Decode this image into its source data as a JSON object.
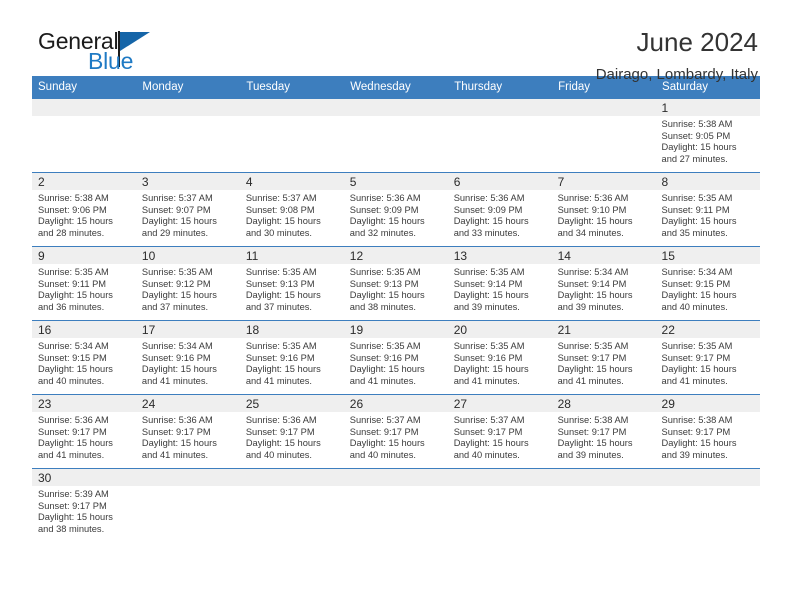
{
  "brand": {
    "name_top": "General",
    "name_bottom": "Blue",
    "accent_color": "#1f7ac4",
    "flag_color": "#1565a8"
  },
  "header": {
    "title": "June 2024",
    "location": "Dairago, Lombardy, Italy"
  },
  "calendar": {
    "header_bg": "#3d7ebe",
    "daynum_bg": "#efefef",
    "weekdays": [
      "Sunday",
      "Monday",
      "Tuesday",
      "Wednesday",
      "Thursday",
      "Friday",
      "Saturday"
    ],
    "weeks": [
      [
        {
          "day": "",
          "sunrise": "",
          "sunset": "",
          "daylight1": "",
          "daylight2": ""
        },
        {
          "day": "",
          "sunrise": "",
          "sunset": "",
          "daylight1": "",
          "daylight2": ""
        },
        {
          "day": "",
          "sunrise": "",
          "sunset": "",
          "daylight1": "",
          "daylight2": ""
        },
        {
          "day": "",
          "sunrise": "",
          "sunset": "",
          "daylight1": "",
          "daylight2": ""
        },
        {
          "day": "",
          "sunrise": "",
          "sunset": "",
          "daylight1": "",
          "daylight2": ""
        },
        {
          "day": "",
          "sunrise": "",
          "sunset": "",
          "daylight1": "",
          "daylight2": ""
        },
        {
          "day": "1",
          "sunrise": "Sunrise: 5:38 AM",
          "sunset": "Sunset: 9:05 PM",
          "daylight1": "Daylight: 15 hours",
          "daylight2": "and 27 minutes."
        }
      ],
      [
        {
          "day": "2",
          "sunrise": "Sunrise: 5:38 AM",
          "sunset": "Sunset: 9:06 PM",
          "daylight1": "Daylight: 15 hours",
          "daylight2": "and 28 minutes."
        },
        {
          "day": "3",
          "sunrise": "Sunrise: 5:37 AM",
          "sunset": "Sunset: 9:07 PM",
          "daylight1": "Daylight: 15 hours",
          "daylight2": "and 29 minutes."
        },
        {
          "day": "4",
          "sunrise": "Sunrise: 5:37 AM",
          "sunset": "Sunset: 9:08 PM",
          "daylight1": "Daylight: 15 hours",
          "daylight2": "and 30 minutes."
        },
        {
          "day": "5",
          "sunrise": "Sunrise: 5:36 AM",
          "sunset": "Sunset: 9:09 PM",
          "daylight1": "Daylight: 15 hours",
          "daylight2": "and 32 minutes."
        },
        {
          "day": "6",
          "sunrise": "Sunrise: 5:36 AM",
          "sunset": "Sunset: 9:09 PM",
          "daylight1": "Daylight: 15 hours",
          "daylight2": "and 33 minutes."
        },
        {
          "day": "7",
          "sunrise": "Sunrise: 5:36 AM",
          "sunset": "Sunset: 9:10 PM",
          "daylight1": "Daylight: 15 hours",
          "daylight2": "and 34 minutes."
        },
        {
          "day": "8",
          "sunrise": "Sunrise: 5:35 AM",
          "sunset": "Sunset: 9:11 PM",
          "daylight1": "Daylight: 15 hours",
          "daylight2": "and 35 minutes."
        }
      ],
      [
        {
          "day": "9",
          "sunrise": "Sunrise: 5:35 AM",
          "sunset": "Sunset: 9:11 PM",
          "daylight1": "Daylight: 15 hours",
          "daylight2": "and 36 minutes."
        },
        {
          "day": "10",
          "sunrise": "Sunrise: 5:35 AM",
          "sunset": "Sunset: 9:12 PM",
          "daylight1": "Daylight: 15 hours",
          "daylight2": "and 37 minutes."
        },
        {
          "day": "11",
          "sunrise": "Sunrise: 5:35 AM",
          "sunset": "Sunset: 9:13 PM",
          "daylight1": "Daylight: 15 hours",
          "daylight2": "and 37 minutes."
        },
        {
          "day": "12",
          "sunrise": "Sunrise: 5:35 AM",
          "sunset": "Sunset: 9:13 PM",
          "daylight1": "Daylight: 15 hours",
          "daylight2": "and 38 minutes."
        },
        {
          "day": "13",
          "sunrise": "Sunrise: 5:35 AM",
          "sunset": "Sunset: 9:14 PM",
          "daylight1": "Daylight: 15 hours",
          "daylight2": "and 39 minutes."
        },
        {
          "day": "14",
          "sunrise": "Sunrise: 5:34 AM",
          "sunset": "Sunset: 9:14 PM",
          "daylight1": "Daylight: 15 hours",
          "daylight2": "and 39 minutes."
        },
        {
          "day": "15",
          "sunrise": "Sunrise: 5:34 AM",
          "sunset": "Sunset: 9:15 PM",
          "daylight1": "Daylight: 15 hours",
          "daylight2": "and 40 minutes."
        }
      ],
      [
        {
          "day": "16",
          "sunrise": "Sunrise: 5:34 AM",
          "sunset": "Sunset: 9:15 PM",
          "daylight1": "Daylight: 15 hours",
          "daylight2": "and 40 minutes."
        },
        {
          "day": "17",
          "sunrise": "Sunrise: 5:34 AM",
          "sunset": "Sunset: 9:16 PM",
          "daylight1": "Daylight: 15 hours",
          "daylight2": "and 41 minutes."
        },
        {
          "day": "18",
          "sunrise": "Sunrise: 5:35 AM",
          "sunset": "Sunset: 9:16 PM",
          "daylight1": "Daylight: 15 hours",
          "daylight2": "and 41 minutes."
        },
        {
          "day": "19",
          "sunrise": "Sunrise: 5:35 AM",
          "sunset": "Sunset: 9:16 PM",
          "daylight1": "Daylight: 15 hours",
          "daylight2": "and 41 minutes."
        },
        {
          "day": "20",
          "sunrise": "Sunrise: 5:35 AM",
          "sunset": "Sunset: 9:16 PM",
          "daylight1": "Daylight: 15 hours",
          "daylight2": "and 41 minutes."
        },
        {
          "day": "21",
          "sunrise": "Sunrise: 5:35 AM",
          "sunset": "Sunset: 9:17 PM",
          "daylight1": "Daylight: 15 hours",
          "daylight2": "and 41 minutes."
        },
        {
          "day": "22",
          "sunrise": "Sunrise: 5:35 AM",
          "sunset": "Sunset: 9:17 PM",
          "daylight1": "Daylight: 15 hours",
          "daylight2": "and 41 minutes."
        }
      ],
      [
        {
          "day": "23",
          "sunrise": "Sunrise: 5:36 AM",
          "sunset": "Sunset: 9:17 PM",
          "daylight1": "Daylight: 15 hours",
          "daylight2": "and 41 minutes."
        },
        {
          "day": "24",
          "sunrise": "Sunrise: 5:36 AM",
          "sunset": "Sunset: 9:17 PM",
          "daylight1": "Daylight: 15 hours",
          "daylight2": "and 41 minutes."
        },
        {
          "day": "25",
          "sunrise": "Sunrise: 5:36 AM",
          "sunset": "Sunset: 9:17 PM",
          "daylight1": "Daylight: 15 hours",
          "daylight2": "and 40 minutes."
        },
        {
          "day": "26",
          "sunrise": "Sunrise: 5:37 AM",
          "sunset": "Sunset: 9:17 PM",
          "daylight1": "Daylight: 15 hours",
          "daylight2": "and 40 minutes."
        },
        {
          "day": "27",
          "sunrise": "Sunrise: 5:37 AM",
          "sunset": "Sunset: 9:17 PM",
          "daylight1": "Daylight: 15 hours",
          "daylight2": "and 40 minutes."
        },
        {
          "day": "28",
          "sunrise": "Sunrise: 5:38 AM",
          "sunset": "Sunset: 9:17 PM",
          "daylight1": "Daylight: 15 hours",
          "daylight2": "and 39 minutes."
        },
        {
          "day": "29",
          "sunrise": "Sunrise: 5:38 AM",
          "sunset": "Sunset: 9:17 PM",
          "daylight1": "Daylight: 15 hours",
          "daylight2": "and 39 minutes."
        }
      ],
      [
        {
          "day": "30",
          "sunrise": "Sunrise: 5:39 AM",
          "sunset": "Sunset: 9:17 PM",
          "daylight1": "Daylight: 15 hours",
          "daylight2": "and 38 minutes."
        },
        {
          "day": "",
          "sunrise": "",
          "sunset": "",
          "daylight1": "",
          "daylight2": ""
        },
        {
          "day": "",
          "sunrise": "",
          "sunset": "",
          "daylight1": "",
          "daylight2": ""
        },
        {
          "day": "",
          "sunrise": "",
          "sunset": "",
          "daylight1": "",
          "daylight2": ""
        },
        {
          "day": "",
          "sunrise": "",
          "sunset": "",
          "daylight1": "",
          "daylight2": ""
        },
        {
          "day": "",
          "sunrise": "",
          "sunset": "",
          "daylight1": "",
          "daylight2": ""
        },
        {
          "day": "",
          "sunrise": "",
          "sunset": "",
          "daylight1": "",
          "daylight2": ""
        }
      ]
    ]
  }
}
